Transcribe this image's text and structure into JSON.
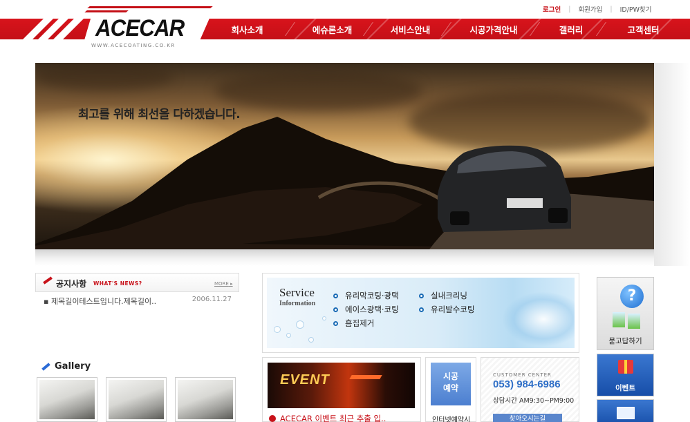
{
  "util": {
    "login": "로그인",
    "join": "회원가입",
    "find": "ID/PW찾기"
  },
  "brand": {
    "logo": "ACECAR",
    "url": "WWW.ACECOATING.CO.KR"
  },
  "nav": [
    "회사소개",
    "에슈론소개",
    "서비스안내",
    "시공가격안내",
    "갤러리",
    "고객센터"
  ],
  "hero": {
    "tagline": "최고를 위해 최선을 다하겠습니다."
  },
  "notice": {
    "title": "공지사항",
    "subtitle": "WHAT'S NEWS?",
    "more": "MORE",
    "items": [
      {
        "text": "제목길이테스트입니다.제목길이..",
        "date": "2006.11.27"
      }
    ]
  },
  "gallery": {
    "title": "Gallery"
  },
  "service": {
    "title": "Service",
    "subtitle": "Information",
    "items": [
      "유리막코팅·광택",
      "실내크리닝",
      "에이스광택·코팅",
      "유리발수코팅",
      "흠집제거"
    ]
  },
  "event": {
    "banner": "EVENT",
    "text": "ACECAR 이벤트 최근 추출 입.."
  },
  "reserve": {
    "button": "시공\n예약",
    "label": "인터넷예약시"
  },
  "customer": {
    "title": "CUSTOMER CENTER",
    "phone": "053) 984-6986",
    "hours": "상담시간 AM9:30~PM9:00",
    "button": "찾아오시는길"
  },
  "side": {
    "qa": "묻고답하기",
    "event": "이벤트"
  },
  "colors": {
    "brand_red": "#c40f16",
    "accent_blue": "#2f6fc7"
  }
}
